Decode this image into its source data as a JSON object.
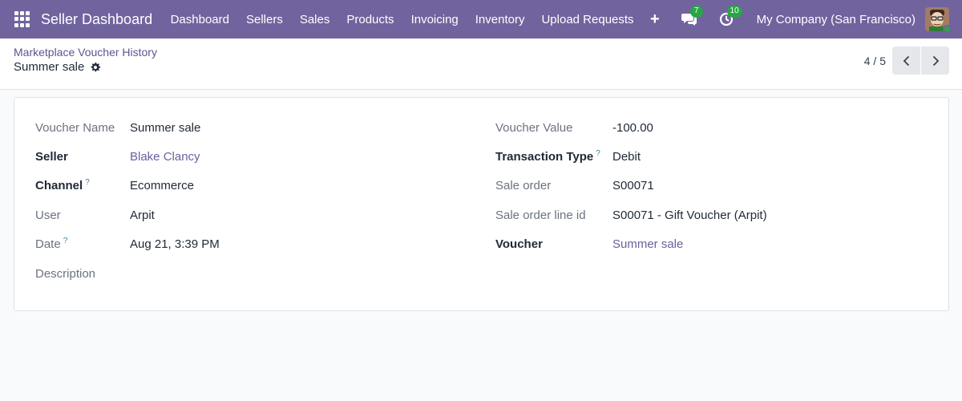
{
  "navbar": {
    "brand": "Seller Dashboard",
    "menu": [
      "Dashboard",
      "Sellers",
      "Sales",
      "Products",
      "Invoicing",
      "Inventory",
      "Upload Requests"
    ],
    "plus": "+",
    "messages_count": "7",
    "activities_count": "10",
    "company": "My Company (San Francisco)",
    "color": "#71639e"
  },
  "control": {
    "breadcrumb": "Marketplace Voucher History",
    "record_title": "Summer sale",
    "pager_value": "4 / 5"
  },
  "form": {
    "left": [
      {
        "label": "Voucher Name",
        "value": "Summer sale"
      },
      {
        "label": "Seller",
        "value": "Blake Clancy"
      },
      {
        "label": "Channel",
        "help": "?",
        "value": "Ecommerce"
      },
      {
        "label": "User",
        "value": "Arpit"
      },
      {
        "label": "Date",
        "help": "?",
        "value": "Aug 21, 3:39 PM"
      },
      {
        "label": "Description",
        "value": ""
      }
    ],
    "right": [
      {
        "label": "Voucher Value",
        "value": "-100.00"
      },
      {
        "label": "Transaction Type",
        "help": "?",
        "value": "Debit"
      },
      {
        "label": "Sale order",
        "value": "S00071"
      },
      {
        "label": "Sale order line id",
        "value": "S00071 - Gift Voucher (Arpit)"
      },
      {
        "label": "Voucher",
        "value": "Summer sale"
      }
    ]
  }
}
